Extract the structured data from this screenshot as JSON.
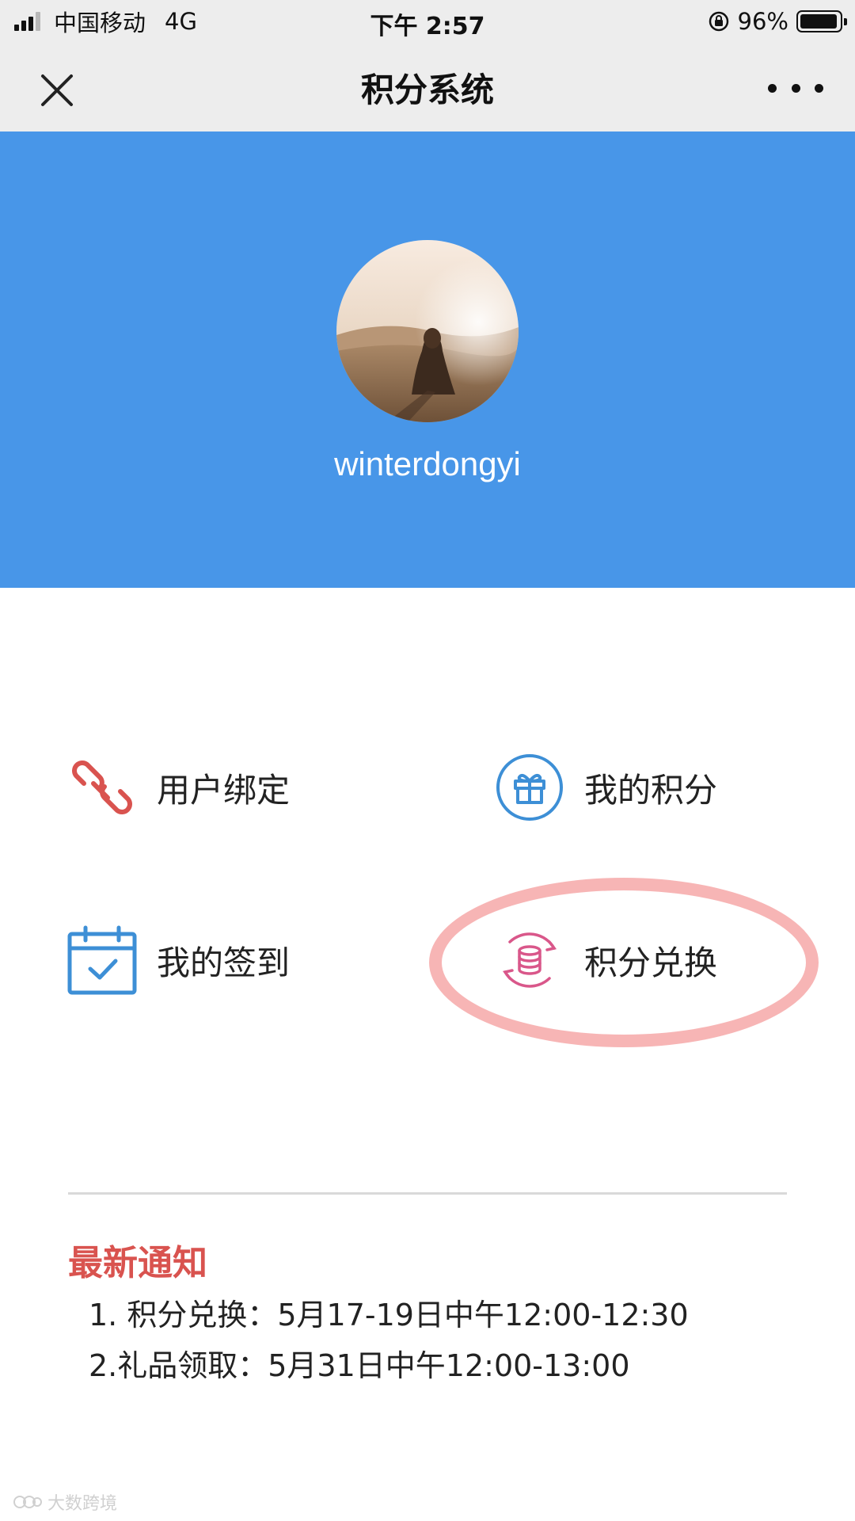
{
  "status_bar": {
    "carrier": "中国移动",
    "network": "4G",
    "time": "下午 2:57",
    "battery": "96%",
    "battery_level": 0.96
  },
  "nav": {
    "title": "积分系统",
    "close_icon": "close-icon",
    "more_icon": "more-icon"
  },
  "profile": {
    "username": "winterdongyi",
    "header_color": "#4896e8"
  },
  "menu": {
    "items": [
      {
        "label": "用户绑定",
        "icon": "link-icon",
        "color": "#d9534f"
      },
      {
        "label": "我的积分",
        "icon": "gift-icon",
        "color": "#3d8fd6"
      },
      {
        "label": "我的签到",
        "icon": "calendar-check-icon",
        "color": "#3d8fd6"
      },
      {
        "label": "积分兑换",
        "icon": "exchange-coins-icon",
        "color": "#d9578a"
      }
    ]
  },
  "notice": {
    "title": "最新通知",
    "title_color": "#d9534f",
    "items": [
      "1. 积分兑换：5月17-19日中午12:00-12:30",
      "2.礼品领取：5月31日中午12:00-13:00"
    ]
  },
  "watermark": "大数跨境"
}
